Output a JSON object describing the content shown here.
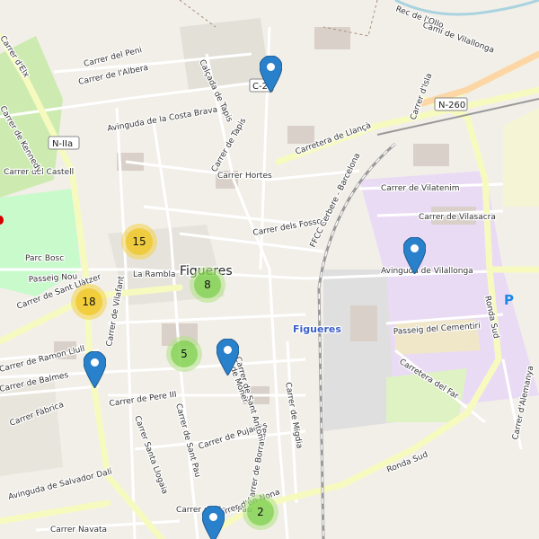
{
  "map": {
    "city_name": "Figueres",
    "station_label": "Figueres",
    "parking_symbol": "P",
    "road_shields": [
      "N-IIa",
      "N-260",
      "C-2"
    ],
    "street_labels": [
      "Carrer del Peni",
      "Carrer de l'Albera",
      "Avinguda de la Costa Brava",
      "Calçada de Tapis",
      "Carrer de Tapis",
      "Carretera de Llançà",
      "Carrer Hortes",
      "Carrer dels Fossos",
      "FFCC Cerbere - Barcelona",
      "Carrer de Vilatenim",
      "Carrer de Vilasacra",
      "Avinguda de Vilallonga",
      "Passeig del Cementiri",
      "Carretera del Far",
      "Ronda Sud",
      "Ronda Sud",
      "La Rambla",
      "Passeig Nou",
      "Parc Bosc",
      "Carrer del Castell",
      "Carrer de Ramon Llull",
      "Carrer de Balmes",
      "Carrer de Vilafant",
      "Carrer de Pere III",
      "Carrer Santa Llogaia",
      "Carrer de Sant Pau",
      "Carrer de Pujades",
      "Carrer de Borrassà",
      "Carrer Navata",
      "Carrer de Sant Antoni",
      "Carrer de Moner",
      "Carrer de Migdia",
      "Carrer d'Alemanya",
      "Carrer d'Elx",
      "Carrer de Kennedy",
      "Carrer de Sant Pau",
      "Camí de Vilallonga",
      "Rec de l'Ollo",
      "Carrer d'Isla",
      "Carrer de Sant Llàtzer",
      "Carrer Fàbrica",
      "Carrer d'en Nona",
      "Avinguda de Salvador Dalí"
    ],
    "clusters": [
      {
        "count": "15",
        "color": "yellow"
      },
      {
        "count": "18",
        "color": "yellow"
      },
      {
        "count": "8",
        "color": "green"
      },
      {
        "count": "5",
        "color": "green"
      },
      {
        "count": "2",
        "color": "green"
      }
    ],
    "markers": [
      "marker-1",
      "marker-2",
      "marker-3",
      "marker-4",
      "marker-5"
    ],
    "colors": {
      "cluster_yellow": "#f0c20c",
      "cluster_green": "#6ecc39",
      "marker_blue": "#2a81cb",
      "major_road": "#f7fabf",
      "water": "#aad3df",
      "railway": "#999999"
    }
  }
}
